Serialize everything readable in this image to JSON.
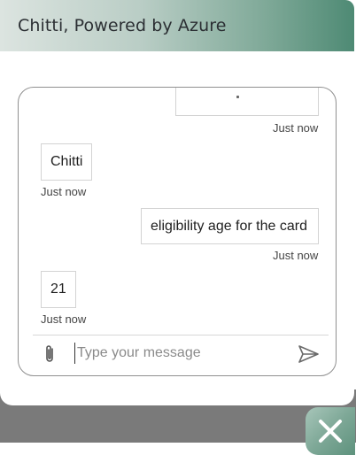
{
  "header": {
    "title": "Chitti, Powered by Azure"
  },
  "messages": [
    {
      "sender": "user",
      "text": "",
      "timestamp": "Just now"
    },
    {
      "sender": "bot",
      "text": "Chitti",
      "timestamp": "Just now"
    },
    {
      "sender": "user",
      "text": "eligibility age for the card",
      "timestamp": "Just now"
    },
    {
      "sender": "bot",
      "text": "21",
      "timestamp": "Just now"
    }
  ],
  "composer": {
    "placeholder": "Type your message",
    "value": ""
  },
  "icons": {
    "attach": "paperclip-icon",
    "send": "send-icon",
    "close": "close-icon"
  },
  "colors": {
    "header_accent": "#4e8a74",
    "close_button": "#7ea897"
  }
}
